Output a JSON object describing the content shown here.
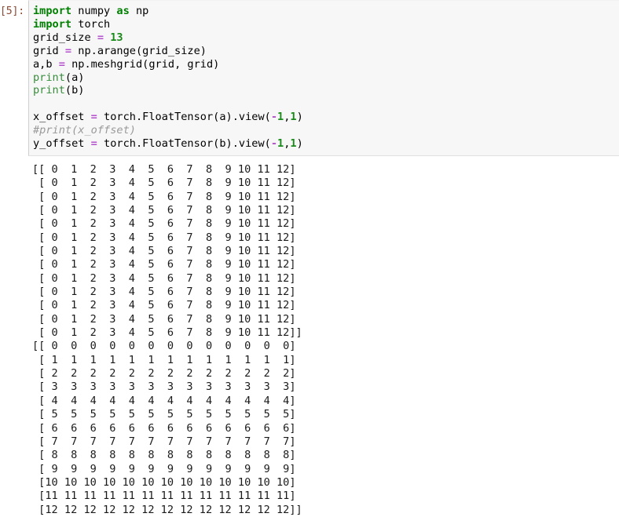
{
  "cell": {
    "prompt_label": "[5]:",
    "execution_count": 5,
    "code_lines": [
      [
        {
          "t": "import",
          "c": "k"
        },
        {
          "t": " numpy ",
          "c": "n"
        },
        {
          "t": "as",
          "c": "k"
        },
        {
          "t": " np",
          "c": "n"
        }
      ],
      [
        {
          "t": "import",
          "c": "k"
        },
        {
          "t": " torch",
          "c": "n"
        }
      ],
      [
        {
          "t": "grid_size ",
          "c": "n"
        },
        {
          "t": "=",
          "c": "op"
        },
        {
          "t": " ",
          "c": "n"
        },
        {
          "t": "13",
          "c": "mi"
        }
      ],
      [
        {
          "t": "grid ",
          "c": "n"
        },
        {
          "t": "=",
          "c": "op"
        },
        {
          "t": " np.arange(grid_size)",
          "c": "n"
        }
      ],
      [
        {
          "t": "a,b ",
          "c": "n"
        },
        {
          "t": "=",
          "c": "op"
        },
        {
          "t": " np.meshgrid(grid, grid)",
          "c": "n"
        }
      ],
      [
        {
          "t": "print",
          "c": "nb"
        },
        {
          "t": "(a)",
          "c": "n"
        }
      ],
      [
        {
          "t": "print",
          "c": "nb"
        },
        {
          "t": "(b)",
          "c": "n"
        }
      ],
      [
        {
          "t": "",
          "c": "n"
        }
      ],
      [
        {
          "t": "x_offset ",
          "c": "n"
        },
        {
          "t": "=",
          "c": "op"
        },
        {
          "t": " torch.FloatTensor(a).view(",
          "c": "n"
        },
        {
          "t": "-",
          "c": "op"
        },
        {
          "t": "1",
          "c": "mi"
        },
        {
          "t": ",",
          "c": "n"
        },
        {
          "t": "1",
          "c": "mi"
        },
        {
          "t": ")",
          "c": "n"
        }
      ],
      [
        {
          "t": "#print(x_offset)",
          "c": "c"
        }
      ],
      [
        {
          "t": "y_offset ",
          "c": "n"
        },
        {
          "t": "=",
          "c": "op"
        },
        {
          "t": " torch.FloatTensor(b).view(",
          "c": "n"
        },
        {
          "t": "-",
          "c": "op"
        },
        {
          "t": "1",
          "c": "mi"
        },
        {
          "t": ",",
          "c": "n"
        },
        {
          "t": "1",
          "c": "mi"
        },
        {
          "t": ")",
          "c": "n"
        }
      ]
    ],
    "code_text": "import numpy as np\nimport torch\ngrid_size = 13\ngrid = np.arange(grid_size)\na,b = np.meshgrid(grid, grid)\nprint(a)\nprint(b)\n\nx_offset = torch.FloatTensor(a).view(-1,1)\n#print(x_offset)\ny_offset = torch.FloatTensor(b).view(-1,1)"
  },
  "output": {
    "stream_name": "stdout",
    "text": "[[ 0  1  2  3  4  5  6  7  8  9 10 11 12]\n [ 0  1  2  3  4  5  6  7  8  9 10 11 12]\n [ 0  1  2  3  4  5  6  7  8  9 10 11 12]\n [ 0  1  2  3  4  5  6  7  8  9 10 11 12]\n [ 0  1  2  3  4  5  6  7  8  9 10 11 12]\n [ 0  1  2  3  4  5  6  7  8  9 10 11 12]\n [ 0  1  2  3  4  5  6  7  8  9 10 11 12]\n [ 0  1  2  3  4  5  6  7  8  9 10 11 12]\n [ 0  1  2  3  4  5  6  7  8  9 10 11 12]\n [ 0  1  2  3  4  5  6  7  8  9 10 11 12]\n [ 0  1  2  3  4  5  6  7  8  9 10 11 12]\n [ 0  1  2  3  4  5  6  7  8  9 10 11 12]\n [ 0  1  2  3  4  5  6  7  8  9 10 11 12]]\n[[ 0  0  0  0  0  0  0  0  0  0  0  0  0]\n [ 1  1  1  1  1  1  1  1  1  1  1  1  1]\n [ 2  2  2  2  2  2  2  2  2  2  2  2  2]\n [ 3  3  3  3  3  3  3  3  3  3  3  3  3]\n [ 4  4  4  4  4  4  4  4  4  4  4  4  4]\n [ 5  5  5  5  5  5  5  5  5  5  5  5  5]\n [ 6  6  6  6  6  6  6  6  6  6  6  6  6]\n [ 7  7  7  7  7  7  7  7  7  7  7  7  7]\n [ 8  8  8  8  8  8  8  8  8  8  8  8  8]\n [ 9  9  9  9  9  9  9  9  9  9  9  9  9]\n [10 10 10 10 10 10 10 10 10 10 10 10 10]\n [11 11 11 11 11 11 11 11 11 11 11 11 11]\n [12 12 12 12 12 12 12 12 12 12 12 12 12]]"
  },
  "colors": {
    "cell_input_background": "#f7f7f7",
    "page_background": "#ffffff",
    "prompt_text": "#8b4a33",
    "keyword": "#008000",
    "builtin": "#388e3c",
    "number": "#1a8a1a",
    "operator": "#b452cd",
    "comment": "#9a9a9a",
    "output_text": "#1a1a1a",
    "cell_left_border": "#cfcfcf"
  }
}
